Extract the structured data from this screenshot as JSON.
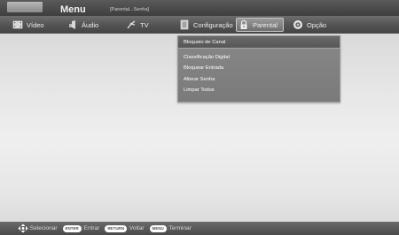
{
  "header": {
    "menu_title": "Menu",
    "breadcrumb": "[Parental...Senha]"
  },
  "tabs": [
    {
      "label": "Vídeo",
      "icon": "film-icon"
    },
    {
      "label": "Áudio",
      "icon": "speaker-icon"
    },
    {
      "label": "TV",
      "icon": "antenna-icon"
    },
    {
      "label": "Configuração",
      "icon": "settings-panel-icon"
    },
    {
      "label": "Parental",
      "icon": "lock-icon",
      "active": true
    },
    {
      "label": "Opção",
      "icon": "disc-icon"
    }
  ],
  "dropdown": {
    "header": "Bloqueio de Canal",
    "items": [
      "Classificação Digital",
      "Bloquear Entrada",
      "Alterar Senha",
      "Limpar Todos"
    ]
  },
  "footer": {
    "select_label": ":Selecionar",
    "enter_key": "ENTER",
    "enter_label": ":Entrar",
    "return_key": "RETURN",
    "return_label": ":Voltar",
    "menu_key": "MENU",
    "menu_label": ":Terminar"
  },
  "colors": {
    "bar_dark": "#454545",
    "background": "#e7e7e7",
    "menu_panel": "#7e7e7e"
  }
}
